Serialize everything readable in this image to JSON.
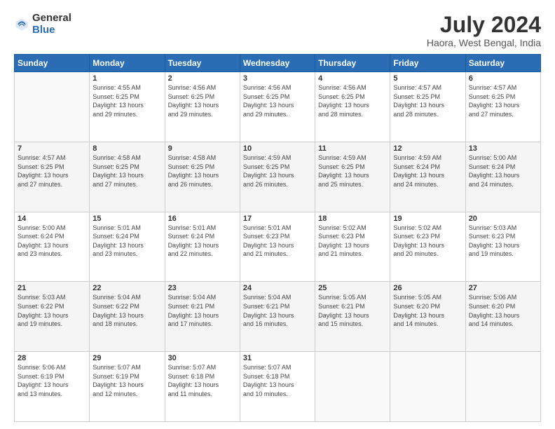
{
  "logo": {
    "general": "General",
    "blue": "Blue"
  },
  "title": "July 2024",
  "subtitle": "Haora, West Bengal, India",
  "header_days": [
    "Sunday",
    "Monday",
    "Tuesday",
    "Wednesday",
    "Thursday",
    "Friday",
    "Saturday"
  ],
  "weeks": [
    [
      {
        "num": "",
        "info": ""
      },
      {
        "num": "1",
        "info": "Sunrise: 4:55 AM\nSunset: 6:25 PM\nDaylight: 13 hours\nand 29 minutes."
      },
      {
        "num": "2",
        "info": "Sunrise: 4:56 AM\nSunset: 6:25 PM\nDaylight: 13 hours\nand 29 minutes."
      },
      {
        "num": "3",
        "info": "Sunrise: 4:56 AM\nSunset: 6:25 PM\nDaylight: 13 hours\nand 29 minutes."
      },
      {
        "num": "4",
        "info": "Sunrise: 4:56 AM\nSunset: 6:25 PM\nDaylight: 13 hours\nand 28 minutes."
      },
      {
        "num": "5",
        "info": "Sunrise: 4:57 AM\nSunset: 6:25 PM\nDaylight: 13 hours\nand 28 minutes."
      },
      {
        "num": "6",
        "info": "Sunrise: 4:57 AM\nSunset: 6:25 PM\nDaylight: 13 hours\nand 27 minutes."
      }
    ],
    [
      {
        "num": "7",
        "info": "Sunrise: 4:57 AM\nSunset: 6:25 PM\nDaylight: 13 hours\nand 27 minutes."
      },
      {
        "num": "8",
        "info": "Sunrise: 4:58 AM\nSunset: 6:25 PM\nDaylight: 13 hours\nand 27 minutes."
      },
      {
        "num": "9",
        "info": "Sunrise: 4:58 AM\nSunset: 6:25 PM\nDaylight: 13 hours\nand 26 minutes."
      },
      {
        "num": "10",
        "info": "Sunrise: 4:59 AM\nSunset: 6:25 PM\nDaylight: 13 hours\nand 26 minutes."
      },
      {
        "num": "11",
        "info": "Sunrise: 4:59 AM\nSunset: 6:25 PM\nDaylight: 13 hours\nand 25 minutes."
      },
      {
        "num": "12",
        "info": "Sunrise: 4:59 AM\nSunset: 6:24 PM\nDaylight: 13 hours\nand 24 minutes."
      },
      {
        "num": "13",
        "info": "Sunrise: 5:00 AM\nSunset: 6:24 PM\nDaylight: 13 hours\nand 24 minutes."
      }
    ],
    [
      {
        "num": "14",
        "info": "Sunrise: 5:00 AM\nSunset: 6:24 PM\nDaylight: 13 hours\nand 23 minutes."
      },
      {
        "num": "15",
        "info": "Sunrise: 5:01 AM\nSunset: 6:24 PM\nDaylight: 13 hours\nand 23 minutes."
      },
      {
        "num": "16",
        "info": "Sunrise: 5:01 AM\nSunset: 6:24 PM\nDaylight: 13 hours\nand 22 minutes."
      },
      {
        "num": "17",
        "info": "Sunrise: 5:01 AM\nSunset: 6:23 PM\nDaylight: 13 hours\nand 21 minutes."
      },
      {
        "num": "18",
        "info": "Sunrise: 5:02 AM\nSunset: 6:23 PM\nDaylight: 13 hours\nand 21 minutes."
      },
      {
        "num": "19",
        "info": "Sunrise: 5:02 AM\nSunset: 6:23 PM\nDaylight: 13 hours\nand 20 minutes."
      },
      {
        "num": "20",
        "info": "Sunrise: 5:03 AM\nSunset: 6:23 PM\nDaylight: 13 hours\nand 19 minutes."
      }
    ],
    [
      {
        "num": "21",
        "info": "Sunrise: 5:03 AM\nSunset: 6:22 PM\nDaylight: 13 hours\nand 19 minutes."
      },
      {
        "num": "22",
        "info": "Sunrise: 5:04 AM\nSunset: 6:22 PM\nDaylight: 13 hours\nand 18 minutes."
      },
      {
        "num": "23",
        "info": "Sunrise: 5:04 AM\nSunset: 6:21 PM\nDaylight: 13 hours\nand 17 minutes."
      },
      {
        "num": "24",
        "info": "Sunrise: 5:04 AM\nSunset: 6:21 PM\nDaylight: 13 hours\nand 16 minutes."
      },
      {
        "num": "25",
        "info": "Sunrise: 5:05 AM\nSunset: 6:21 PM\nDaylight: 13 hours\nand 15 minutes."
      },
      {
        "num": "26",
        "info": "Sunrise: 5:05 AM\nSunset: 6:20 PM\nDaylight: 13 hours\nand 14 minutes."
      },
      {
        "num": "27",
        "info": "Sunrise: 5:06 AM\nSunset: 6:20 PM\nDaylight: 13 hours\nand 14 minutes."
      }
    ],
    [
      {
        "num": "28",
        "info": "Sunrise: 5:06 AM\nSunset: 6:19 PM\nDaylight: 13 hours\nand 13 minutes."
      },
      {
        "num": "29",
        "info": "Sunrise: 5:07 AM\nSunset: 6:19 PM\nDaylight: 13 hours\nand 12 minutes."
      },
      {
        "num": "30",
        "info": "Sunrise: 5:07 AM\nSunset: 6:18 PM\nDaylight: 13 hours\nand 11 minutes."
      },
      {
        "num": "31",
        "info": "Sunrise: 5:07 AM\nSunset: 6:18 PM\nDaylight: 13 hours\nand 10 minutes."
      },
      {
        "num": "",
        "info": ""
      },
      {
        "num": "",
        "info": ""
      },
      {
        "num": "",
        "info": ""
      }
    ]
  ]
}
